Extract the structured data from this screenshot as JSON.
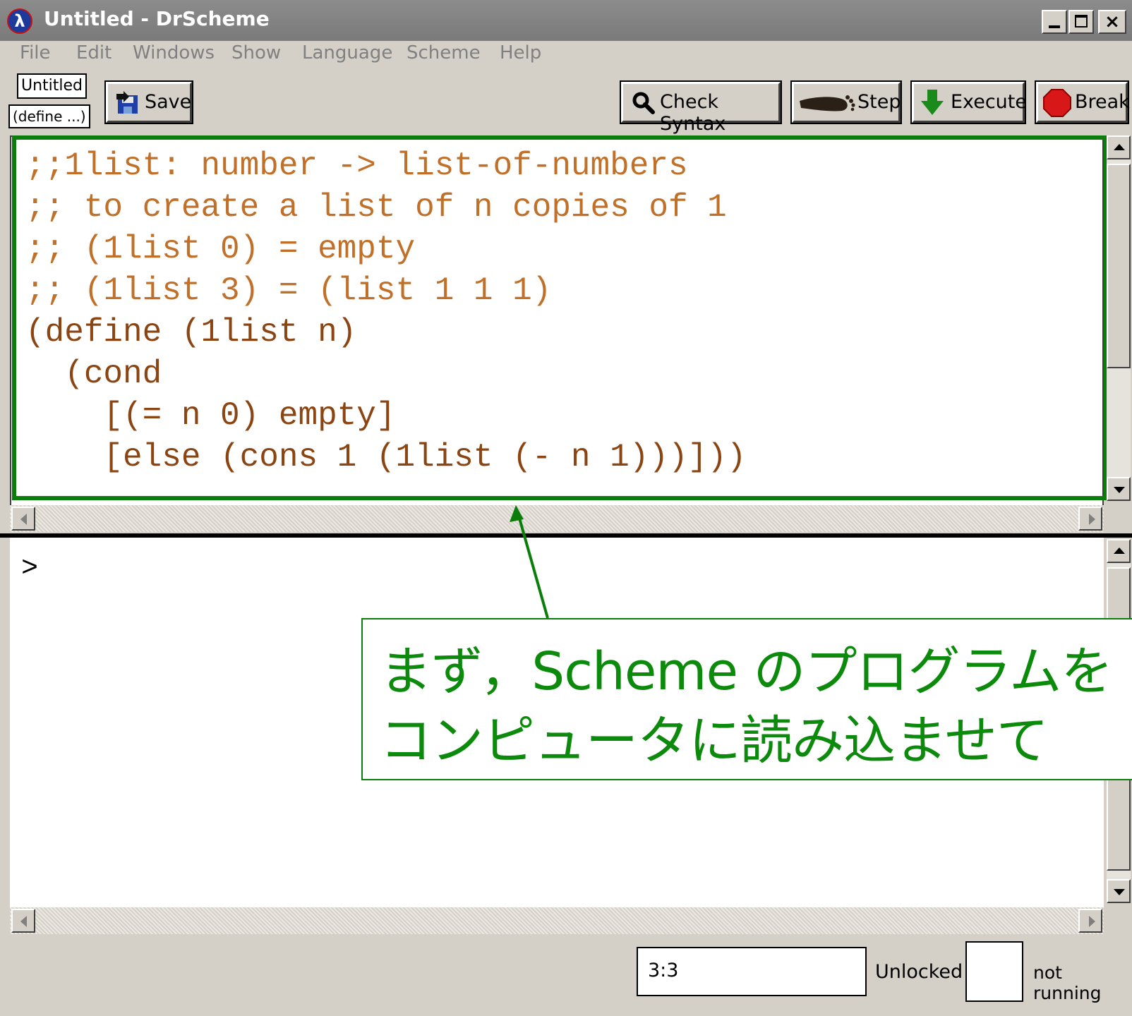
{
  "window": {
    "title": "Untitled - DrScheme",
    "app_icon": "lambda-icon",
    "app_icon_glyph": "λ"
  },
  "menu": [
    {
      "label": "File"
    },
    {
      "label": "Edit"
    },
    {
      "label": "Windows"
    },
    {
      "label": "Show"
    },
    {
      "label": "Language"
    },
    {
      "label": "Scheme"
    },
    {
      "label": "Help"
    }
  ],
  "toolbar": {
    "file_tab": "Untitled",
    "define_menu": "(define ...)",
    "save": "Save",
    "check_syntax": "Check Syntax",
    "step": "Step",
    "execute": "Execute",
    "break": "Break"
  },
  "editor": {
    "lines": [
      ";;1list: number -> list-of-numbers",
      ";; to create a list of n copies of 1",
      ";; (1list 0) = empty",
      ";; (1list 3) = (list 1 1 1)",
      "(define (1list n)",
      "  (cond",
      "    [(= n 0) empty]",
      "    [else (cons 1 (1list (- n 1)))]))"
    ]
  },
  "interactions": {
    "prompt": ">"
  },
  "status": {
    "position": "3:3",
    "lock": "Unlocked",
    "running": "not running"
  },
  "annotation": {
    "line1": "まず，Scheme のプログラムを",
    "line2": "コンピュータに読み込ませて"
  },
  "colors": {
    "annotation_green": "#0b8a0b",
    "comment": "#c07028",
    "identifier": "#006400",
    "number": "#6a5acd",
    "builtin": "#4169e1",
    "paren": "#8b4513"
  }
}
